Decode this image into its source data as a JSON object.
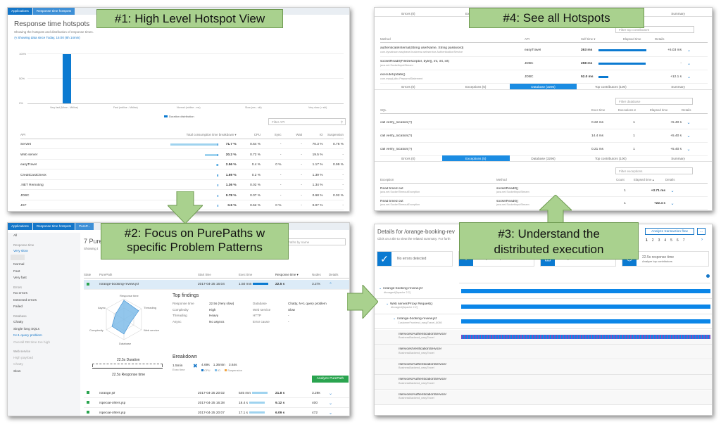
{
  "callouts": {
    "c1": "#1: High Level Hotspot View",
    "c2a": "#2: Focus on PurePaths w",
    "c2b": "specific Problem Patterns",
    "c3a": "#3: Understand the",
    "c3b": "distributed execution",
    "c4": "#4: See all Hotspots"
  },
  "p1": {
    "breadcrumb": [
      "Applications",
      "Response time hotspots"
    ],
    "title": "Response time hotspots",
    "subtitle": "Showing the hotspots and distribution of response times.",
    "since": "Showing data since Today, 15:00 (6h 14min)",
    "y_top": "100%",
    "y_mid": "50%",
    "y_bot": "0%",
    "buckets": [
      "Very fast (Mime - Mbline)",
      "Fast (mbline - Mbline)",
      "Normal (mbline - ms)",
      "Slow (ms - ski)",
      "Very slow (> ski)"
    ],
    "legend": "Duration distribution",
    "filter": "Filter API",
    "cols": [
      "API",
      "Total consumption time breakdown ▾",
      "CPU",
      "Sync",
      "Wait",
      "IO",
      "Suspension"
    ],
    "rows": [
      {
        "api": "Servlet",
        "total": "71.7 %",
        "cpu": "0.64 %",
        "sync": "-",
        "wait": "-",
        "io": "70.3 %",
        "susp": "0.76 %",
        "bar": 0.72
      },
      {
        "api": "Web server",
        "total": "20.2 %",
        "cpu": "0.72 %",
        "sync": "-",
        "wait": "-",
        "io": "19.5 %",
        "susp": "-",
        "bar": 0.2
      },
      {
        "api": "easyTravel",
        "total": "2.56 %",
        "cpu": "0.4 %",
        "sync": "0 %",
        "wait": "-",
        "io": "1.17 %",
        "susp": "0.99 %",
        "bar": 0.03
      },
      {
        "api": "CreditCardCheck",
        "total": "1.69 %",
        "cpu": "0.2 %",
        "sync": "-",
        "wait": "-",
        "io": "1.39 %",
        "susp": "-",
        "bar": 0.02
      },
      {
        "api": ".NET Remoting",
        "total": "1.36 %",
        "cpu": "0.02 %",
        "sync": "-",
        "wait": "-",
        "io": "1.34 %",
        "susp": "-",
        "bar": 0.015
      },
      {
        "api": "JDBC",
        "total": "0.78 %",
        "cpu": "0.07 %",
        "sync": "-",
        "wait": "-",
        "io": "0.68 %",
        "susp": "0.02 %",
        "bar": 0.01
      },
      {
        "api": "JSF",
        "total": "0.6 %",
        "cpu": "0.52 %",
        "sync": "0 %",
        "wait": "-",
        "io": "0.07 %",
        "susp": "-",
        "bar": 0.008
      }
    ]
  },
  "p2": {
    "breadcrumb": [
      "Applications",
      "Response time hotspots",
      "PureP..."
    ],
    "heading": "7 PureP",
    "showing": "Showing t",
    "filter": "ePaths by name",
    "side": {
      "all": "All",
      "sec1": "Response time",
      "rt": [
        "Very slow",
        "Slow",
        "Normal",
        "Fast",
        "Very fast"
      ],
      "sec2": "Errors",
      "err": [
        "No errors",
        "Detected errors",
        "Failed"
      ],
      "sec3": "Database",
      "db": [
        "Chatty",
        "Single long SQLs",
        "N+1 query problem",
        "Overall DB time too high"
      ],
      "sec4": "Web service",
      "ws": [
        "High payload",
        "Chatty",
        "Slow"
      ]
    },
    "cols": [
      "State",
      "PurePath",
      "Start time",
      "Exec time",
      "Response time ▾",
      "Nodes",
      "Details"
    ],
    "main": {
      "name": "/orange-booking-review.jsf",
      "start": "2017-04-25 16:04",
      "exec": "1.50 min",
      "resp": "22.5 s",
      "nodes": "3.27k"
    },
    "radar": [
      "Response time",
      "Threading",
      "Web service",
      "Database",
      "Complexity",
      "Async"
    ],
    "findings": {
      "title": "Top findings",
      "left": [
        [
          "Response time",
          "22.5s (Very slow)"
        ],
        [
          "Complexity",
          "High"
        ],
        [
          "Threading",
          "Heavy"
        ],
        [
          "Async",
          "No asyncs"
        ]
      ],
      "right": [
        [
          "Database",
          "Chatty, N+1 query problem"
        ],
        [
          "Web service",
          "Slow"
        ],
        [
          "HTTP",
          "-"
        ],
        [
          "Error cause",
          "-"
        ]
      ]
    },
    "duration": "22.5s Duration",
    "resptime": "22.5s Response time",
    "breakdown": {
      "title": "Breakdown",
      "exec_val": "1.5min",
      "exec_lbl": "Exec time",
      "v1": "4.69s",
      "v2": "1.36min",
      "v3": "3.64s",
      "l1": "CPU",
      "l2": "IO",
      "l3": "Suspension"
    },
    "analyze": "Analyze PurePath",
    "rows": [
      {
        "name": "/orange.jsf",
        "start": "2017-04-25 20:02",
        "exec": "545 min",
        "resp": "21.8 s",
        "nodes": "3.29k"
      },
      {
        "name": "/special-offers.jsp",
        "start": "2017-04-25 16:38",
        "exec": "18.4 s",
        "resp": "9.12 s",
        "nodes": "400"
      },
      {
        "name": "/special-offers.jsp",
        "start": "2017-04-25 20:07",
        "exec": "17.1 s",
        "resp": "6.09 s",
        "nodes": "472"
      }
    ]
  },
  "p3": {
    "title": "Details for /orange-booking-rev",
    "subtitle": "Click on a tile to view the related summary. For furth",
    "analyze_btn": "Analyze transaction flow",
    "pages": [
      "1",
      "2",
      "3",
      "4",
      "5",
      "6",
      "7"
    ],
    "tiles": [
      "No errors detected",
      "Analyze exception occurrences",
      "Analyze database calls",
      "22.5s response time"
    ],
    "tile4_sub": "Analyze top contributors",
    "spans": [
      {
        "name": "/orange-booking-review.jsf",
        "sub": "dtxxagent[Apache 2.2]"
      },
      {
        "name": "Web server/Proxy Request()",
        "sub": "dtxxagent[Apache 2.2]"
      },
      {
        "name": "/orange-booking-review.jsf",
        "sub": "CustomerFrontend_easyTravel_8080"
      },
      {
        "name": "/services/AuthenticationService/",
        "sub": "BusinessBackend_easyTravel"
      },
      {
        "name": "/services/VerificationService/",
        "sub": "BusinessBackend_easyTravel"
      },
      {
        "name": "/services/AuthenticationService/",
        "sub": "BusinessBackend_easyTravel"
      },
      {
        "name": "/services/AuthenticationService/",
        "sub": "BusinessBackend_easyTravel"
      },
      {
        "name": "/services/AuthenticationService/",
        "sub": "BusinessBackend_easyTravel"
      }
    ]
  },
  "p4": {
    "tabs": [
      "Errors (0)",
      "Exceptions (5)",
      "Database (3296)",
      "Top contributors (100)",
      "Summary"
    ],
    "top_filter": "Filter top contributors",
    "cols1": [
      "Method",
      "API",
      "Self time ▾",
      "Elapsed time",
      "Details"
    ],
    "rows1": [
      {
        "method": "authenticateInternal(String userName, String password)",
        "sub": "com.dynatrace.easytravel.business.webservice.AuthenticationService",
        "api": "easyTravel",
        "self": "263 ms",
        "elapsed": "+6.03 ms",
        "bar": 0.95
      },
      {
        "method": "socketRead0(FileDescriptor, byte[], int, int, int)",
        "sub": "java.net.SocketInputStream",
        "api": "JDBC",
        "self": "258 ms",
        "elapsed": "-",
        "bar": 0.93
      },
      {
        "method": "executeUpdate()",
        "sub": "com.mysql.jdbc.PreparedStatement",
        "api": "JDBC",
        "self": "52.0 ms",
        "elapsed": "+12.1 s",
        "bar": 0.19
      }
    ],
    "db_filter": "Filter database",
    "cols2": [
      "SQL",
      "Exec time",
      "Executions ▾",
      "Elapsed time",
      "Details"
    ],
    "rows2": [
      {
        "sql": "call verify_location(?)",
        "exec": "0.22 ms",
        "execs": "1",
        "elapsed": "+5.40 s"
      },
      {
        "sql": "call verify_location(?)",
        "exec": "14.4 ms",
        "execs": "1",
        "elapsed": "+5.40 s"
      },
      {
        "sql": "call verify_location(?)",
        "exec": "0.21 ms",
        "execs": "1",
        "elapsed": "+5.40 s"
      }
    ],
    "ex_filter": "Filter exceptions",
    "cols3": [
      "Exception",
      "Method",
      "Count",
      "Elapsed time ▴",
      "Details"
    ],
    "rows3": [
      {
        "ex": "Read timed out",
        "exsub": "java.net.SocketTimeoutException",
        "method": "socketRead0()",
        "msub": "java.net.SocketInputStream",
        "count": "1",
        "elapsed": "+3.71 ms"
      },
      {
        "ex": "Read timed out",
        "exsub": "java.net.SocketTimeoutException",
        "method": "socketRead0()",
        "msub": "java.net.SocketInputStream",
        "count": "1",
        "elapsed": "+22.4 s"
      }
    ]
  },
  "colors": {
    "brand": "#1476c8",
    "bar": "#0b7ad1",
    "callout": "#a9d18e"
  }
}
